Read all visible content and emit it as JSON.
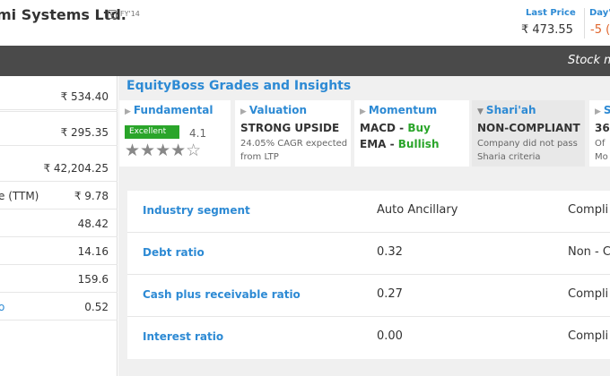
{
  "header": {
    "company_name": "mi Systems Ltd.",
    "consolidated_badge": "C",
    "fy": "FY'14",
    "last_price_label": "Last Price",
    "last_price_value": "₹ 473.55",
    "day_label": "Day'",
    "day_value": "-5 ("
  },
  "banner": {
    "text": "Stock m"
  },
  "left_metrics": [
    {
      "label": "",
      "value": "₹ 534.40"
    },
    {
      "label": "",
      "value": "₹ 295.35"
    },
    {
      "label": "",
      "value": "₹ 42,204.25"
    },
    {
      "label": "e (TTM)",
      "value": "₹ 9.78"
    },
    {
      "label": "",
      "value": "48.42"
    },
    {
      "label": "",
      "value": "14.16"
    },
    {
      "label": "",
      "value": "159.6"
    },
    {
      "label": "o",
      "value": "0.52"
    }
  ],
  "grades": {
    "title": "EquityBoss Grades and Insights",
    "fundamental": {
      "title": "Fundamental",
      "badge": "Excellent",
      "score": "4.1",
      "stars": "★★★★☆",
      "rating": 4.1
    },
    "valuation": {
      "title": "Valuation",
      "headline": "STRONG UPSIDE",
      "line1": "24.05% CAGR expected",
      "line2": "from LTP"
    },
    "momentum": {
      "title": "Momentum",
      "macd_label": "MACD - ",
      "macd_value": "Buy",
      "ema_label": "EMA - ",
      "ema_value": "Bullish"
    },
    "shariah": {
      "title": "Shari'ah",
      "headline": "NON-COMPLIANT",
      "line1": "Company did not pass",
      "line2": "Sharia criteria"
    },
    "next": {
      "title": "S",
      "headline": "36.",
      "line1": "Of ",
      "line2": "Mo"
    }
  },
  "shariah_table": [
    {
      "label": "Industry segment",
      "value": "Auto Ancillary",
      "status": "Compli"
    },
    {
      "label": "Debt ratio",
      "value": "0.32",
      "status": "Non - C"
    },
    {
      "label": "Cash plus receivable ratio",
      "value": "0.27",
      "status": "Compli"
    },
    {
      "label": "Interest ratio",
      "value": "0.00",
      "status": "Compli"
    }
  ],
  "colors": {
    "accent_blue": "#2d8ad4",
    "dark_bar": "#4a4a4a",
    "excellent_green": "#2aa52a",
    "negative_orange": "#e0652c"
  }
}
